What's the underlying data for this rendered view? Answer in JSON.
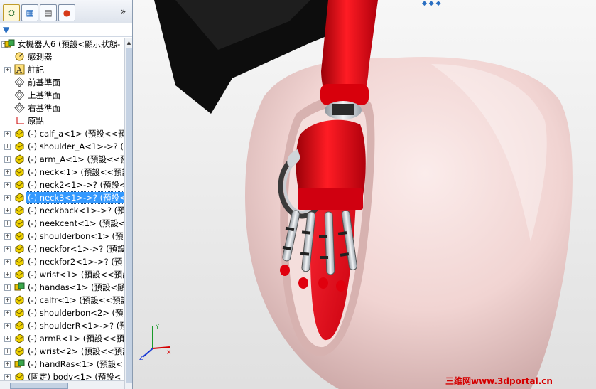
{
  "feature_manager": {
    "tabs": [
      {
        "icon": "feature-manager-tab-icon",
        "glyph": "⛭"
      },
      {
        "icon": "property-manager-tab-icon",
        "glyph": "▦"
      },
      {
        "icon": "configuration-manager-tab-icon",
        "glyph": "▤"
      },
      {
        "icon": "display-manager-tab-icon",
        "glyph": "●"
      }
    ],
    "more_tabs_glyph": "»",
    "filter_glyph": "▼",
    "tree": [
      {
        "label": "女機器人6  (預設<顯示狀態-",
        "icon": "assembly-icon",
        "expander": "−",
        "level": 0
      },
      {
        "label": "感測器",
        "icon": "sensors-icon",
        "expander": "",
        "level": 1
      },
      {
        "label": "註記",
        "icon": "annotations-icon",
        "expander": "+",
        "level": 1
      },
      {
        "label": "前基準面",
        "icon": "plane-icon",
        "expander": "",
        "level": 1
      },
      {
        "label": "上基準面",
        "icon": "plane-icon",
        "expander": "",
        "level": 1
      },
      {
        "label": "右基準面",
        "icon": "plane-icon",
        "expander": "",
        "level": 1
      },
      {
        "label": "原點",
        "icon": "origin-icon",
        "expander": "",
        "level": 1
      },
      {
        "label": "(-) calf_a<1> (預設<<預",
        "icon": "part-icon",
        "expander": "+",
        "level": 1
      },
      {
        "label": "(-) shoulder_A<1>->? (",
        "icon": "part-icon",
        "expander": "+",
        "level": 1
      },
      {
        "label": "(-) arm_A<1> (預設<<預",
        "icon": "part-icon",
        "expander": "+",
        "level": 1
      },
      {
        "label": "(-) neck<1> (預設<<預設",
        "icon": "part-icon",
        "expander": "+",
        "level": 1
      },
      {
        "label": "(-) neck2<1>->? (預設<",
        "icon": "part-icon",
        "expander": "+",
        "level": 1
      },
      {
        "label": "(-) neck3<1>->? (預設<",
        "icon": "part-icon",
        "expander": "+",
        "level": 1,
        "selected": true
      },
      {
        "label": "(-) neckback<1>->? (預",
        "icon": "part-icon",
        "expander": "+",
        "level": 1
      },
      {
        "label": "(-) neekcent<1> (預設<",
        "icon": "part-icon",
        "expander": "+",
        "level": 1
      },
      {
        "label": "(-) shoulderbon<1> (預",
        "icon": "part-icon",
        "expander": "+",
        "level": 1
      },
      {
        "label": "(-) neckfor<1>->? (預設",
        "icon": "part-icon",
        "expander": "+",
        "level": 1
      },
      {
        "label": "(-) neckfor2<1>->? (預",
        "icon": "part-icon",
        "expander": "+",
        "level": 1
      },
      {
        "label": "(-) wrist<1> (預設<<預設",
        "icon": "part-icon",
        "expander": "+",
        "level": 1
      },
      {
        "label": "(-) handas<1> (預設<顯",
        "icon": "subassembly-icon",
        "expander": "+",
        "level": 1
      },
      {
        "label": "(-) calfr<1> (預設<<預設",
        "icon": "part-icon",
        "expander": "+",
        "level": 1
      },
      {
        "label": "(-) shoulderbon<2> (預",
        "icon": "part-icon",
        "expander": "+",
        "level": 1
      },
      {
        "label": "(-) shoulderR<1>->? (預",
        "icon": "part-icon",
        "expander": "+",
        "level": 1
      },
      {
        "label": "(-) armR<1> (預設<<預",
        "icon": "part-icon",
        "expander": "+",
        "level": 1
      },
      {
        "label": "(-) wrist<2> (預設<<預設",
        "icon": "part-icon",
        "expander": "+",
        "level": 1
      },
      {
        "label": "(-) handRas<1> (預設<<",
        "icon": "subassembly-icon",
        "expander": "+",
        "level": 1
      },
      {
        "label": "(固定) body<1> (預設<",
        "icon": "part-icon",
        "expander": "+",
        "level": 1
      }
    ]
  },
  "viewport": {
    "watermark": "三维网www.3dportal.cn",
    "colors": {
      "shell": "#f3d8d6",
      "arm": "#e00010",
      "inner": "#ff1a2a",
      "joint": "#d9dde2",
      "background": "#eaeaea",
      "torso": "#0d0d0d"
    }
  }
}
